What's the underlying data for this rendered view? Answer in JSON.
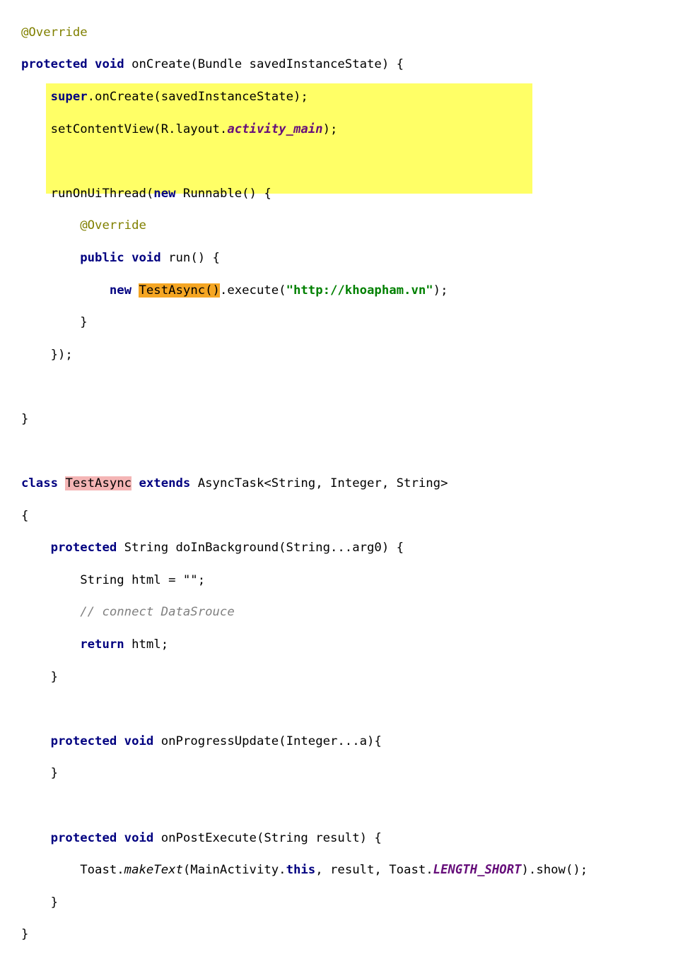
{
  "editor": {
    "highlight_colors": {
      "selection_block": "#ffff66",
      "usage_highlight": "#f5a623",
      "declaration_highlight": "#f4b5b5"
    },
    "tokens": {
      "override": "@Override",
      "protected": "protected",
      "void": "void",
      "public": "public",
      "super": "super",
      "new": "new",
      "class": "class",
      "extends": "extends",
      "return": "return",
      "this": "this",
      "oncreate_sig": " onCreate(Bundle savedInstanceState) {",
      "super_call": ".onCreate(savedInstanceState);",
      "setcontent_pre": "setContentView(R.layout.",
      "activity_main": "activity_main",
      "setcontent_post": ");",
      "runonui_pre": "runOnUiThread(",
      "runnable": " Runnable() {",
      "run_sig": " run() {",
      "testasync_call": "TestAsync()",
      "execute_pre": ".execute(",
      "url": "\"http://khoapham.vn\"",
      "execute_post": ");",
      "close_brace": "}",
      "close_paren": "});",
      "testasync_decl": "TestAsync",
      "asynctask": " AsyncTask<String, Integer, String>",
      "open_brace": "{",
      "string_type": " String doInBackground(String...arg0) {",
      "html_decl": "String html = \"\";",
      "comment": "// connect DataSrouce",
      "return_html": " html;",
      "progress_sig": " onProgressUpdate(Integer...a){",
      "postexec_sig": " onPostExecute(String result) {",
      "toast_pre": "Toast.",
      "maketext": "makeText",
      "toast_mid": "(MainActivity.",
      "toast_mid2": ", result, Toast.",
      "length_short": "LENGTH_SHORT",
      "toast_post": ").show();"
    }
  }
}
